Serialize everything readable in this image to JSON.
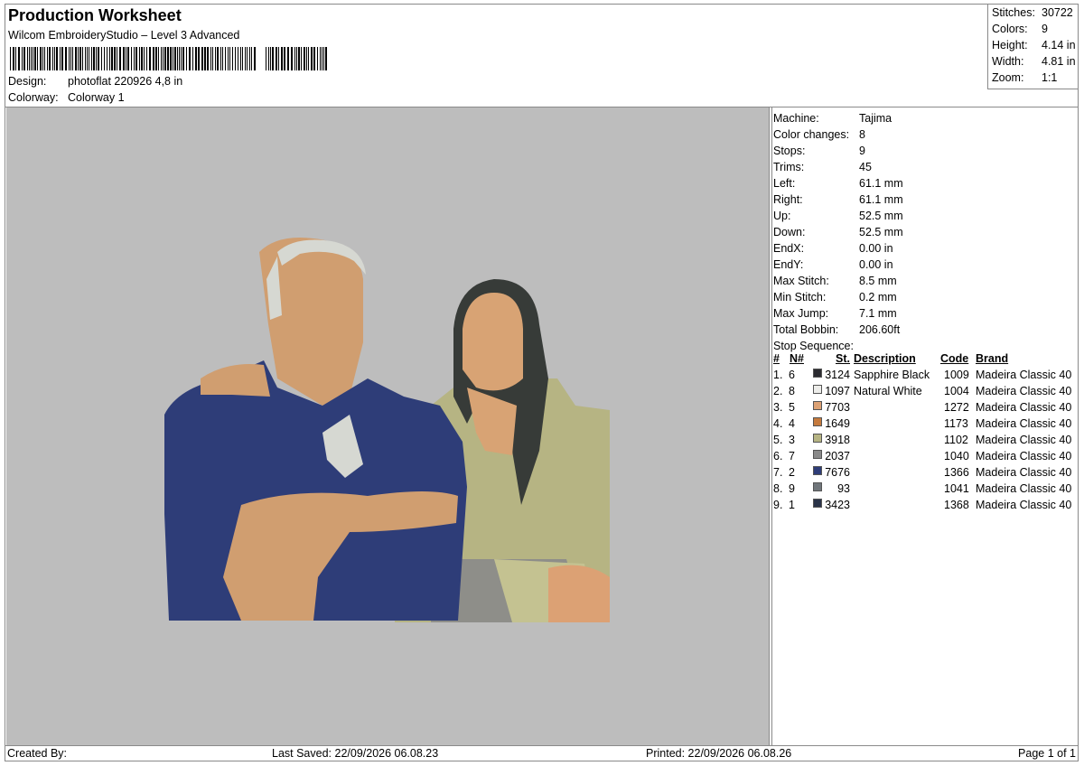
{
  "header": {
    "title": "Production Worksheet",
    "subtitle": "Wilcom EmbroideryStudio – Level 3 Advanced",
    "design_label": "Design:",
    "design_value": "photoflat 220926 4,8 in",
    "colorway_label": "Colorway:",
    "colorway_value": "Colorway 1"
  },
  "stats": [
    {
      "label": "Stitches:",
      "value": "30722"
    },
    {
      "label": "Colors:",
      "value": "9"
    },
    {
      "label": "Height:",
      "value": "4.14 in"
    },
    {
      "label": "Width:",
      "value": "4.81 in"
    },
    {
      "label": "Zoom:",
      "value": "1:1"
    }
  ],
  "machine_info": [
    {
      "label": "Machine:",
      "value": "Tajima"
    },
    {
      "label": "Color changes:",
      "value": "8"
    },
    {
      "label": "Stops:",
      "value": "9"
    },
    {
      "label": "Trims:",
      "value": "45"
    },
    {
      "label": "Left:",
      "value": "61.1 mm"
    },
    {
      "label": "Right:",
      "value": "61.1 mm"
    },
    {
      "label": "Up:",
      "value": "52.5 mm"
    },
    {
      "label": "Down:",
      "value": "52.5 mm"
    },
    {
      "label": "EndX:",
      "value": "0.00 in"
    },
    {
      "label": "EndY:",
      "value": "0.00 in"
    },
    {
      "label": "Max Stitch:",
      "value": "8.5 mm"
    },
    {
      "label": "Min Stitch:",
      "value": "0.2 mm"
    },
    {
      "label": "Max Jump:",
      "value": "7.1 mm"
    },
    {
      "label": "Total Bobbin:",
      "value": "206.60ft"
    }
  ],
  "stop_sequence": {
    "label": "Stop Sequence:",
    "columns": {
      "num": "#",
      "needle": "N#",
      "stitches": "St.",
      "description": "Description",
      "code": "Code",
      "brand": "Brand"
    },
    "rows": [
      {
        "num": "1.",
        "needle": "6",
        "color": "#2b2b30",
        "stitches": "3124",
        "description": "Sapphire Black",
        "code": "1009",
        "brand": "Madeira Classic 40"
      },
      {
        "num": "2.",
        "needle": "8",
        "color": "#ededea",
        "stitches": "1097",
        "description": "Natural White",
        "code": "1004",
        "brand": "Madeira Classic 40"
      },
      {
        "num": "3.",
        "needle": "5",
        "color": "#dca174",
        "stitches": "7703",
        "description": "",
        "code": "1272",
        "brand": "Madeira Classic 40"
      },
      {
        "num": "4.",
        "needle": "4",
        "color": "#c57a3d",
        "stitches": "1649",
        "description": "",
        "code": "1173",
        "brand": "Madeira Classic 40"
      },
      {
        "num": "5.",
        "needle": "3",
        "color": "#b6b483",
        "stitches": "3918",
        "description": "",
        "code": "1102",
        "brand": "Madeira Classic 40"
      },
      {
        "num": "6.",
        "needle": "7",
        "color": "#8a8a8a",
        "stitches": "2037",
        "description": "",
        "code": "1040",
        "brand": "Madeira Classic 40"
      },
      {
        "num": "7.",
        "needle": "2",
        "color": "#2e3d78",
        "stitches": "7676",
        "description": "",
        "code": "1366",
        "brand": "Madeira Classic 40"
      },
      {
        "num": "8.",
        "needle": "9",
        "color": "#70767b",
        "stitches": "93",
        "description": "",
        "code": "1041",
        "brand": "Madeira Classic 40"
      },
      {
        "num": "9.",
        "needle": "1",
        "color": "#2a3348",
        "stitches": "3423",
        "description": "",
        "code": "1368",
        "brand": "Madeira Classic 40"
      }
    ]
  },
  "footer": {
    "created_by": "Created By:",
    "last_saved": "Last Saved: 22/09/2026 06.08.23",
    "printed": "Printed: 22/09/2026 06.08.26",
    "page": "Page 1 of 1"
  }
}
